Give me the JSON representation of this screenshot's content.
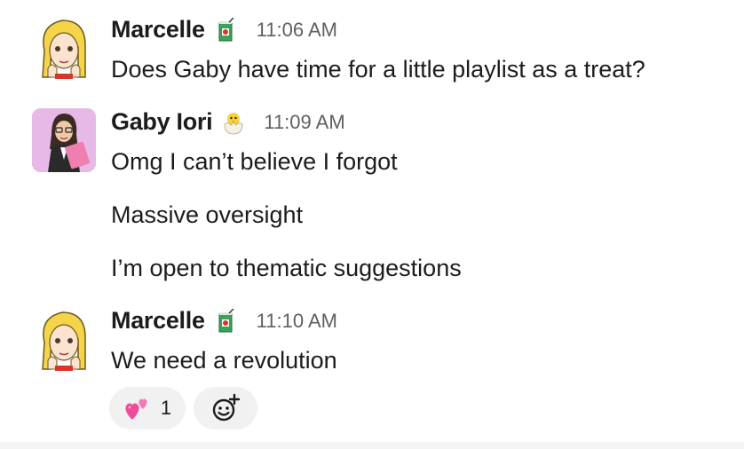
{
  "messages": [
    {
      "sender": "Marcelle",
      "status_icon": "juice-box-icon",
      "timestamp": "11:06 AM",
      "lines": [
        "Does Gaby have time for a little playlist as a treat?"
      ]
    },
    {
      "sender": "Gaby Iori",
      "status_icon": "hatching-chick-icon",
      "timestamp": "11:09 AM",
      "lines": [
        "Omg I can’t believe I forgot",
        "Massive oversight",
        "I’m open to thematic suggestions"
      ]
    },
    {
      "sender": "Marcelle",
      "status_icon": "juice-box-icon",
      "timestamp": "11:10 AM",
      "lines": [
        "We need a revolution"
      ]
    }
  ],
  "reactions": [
    {
      "emoji": "two-hearts-icon",
      "count": "1"
    }
  ],
  "add_reaction_icon": "add-reaction-icon",
  "colors": {
    "text": "#1d1c1d",
    "timestamp": "#616061",
    "reaction_bg": "#f1f1f1",
    "heart_pink": "#ec4c9a",
    "gaby_avatar_bg": "#e6b9e6"
  }
}
